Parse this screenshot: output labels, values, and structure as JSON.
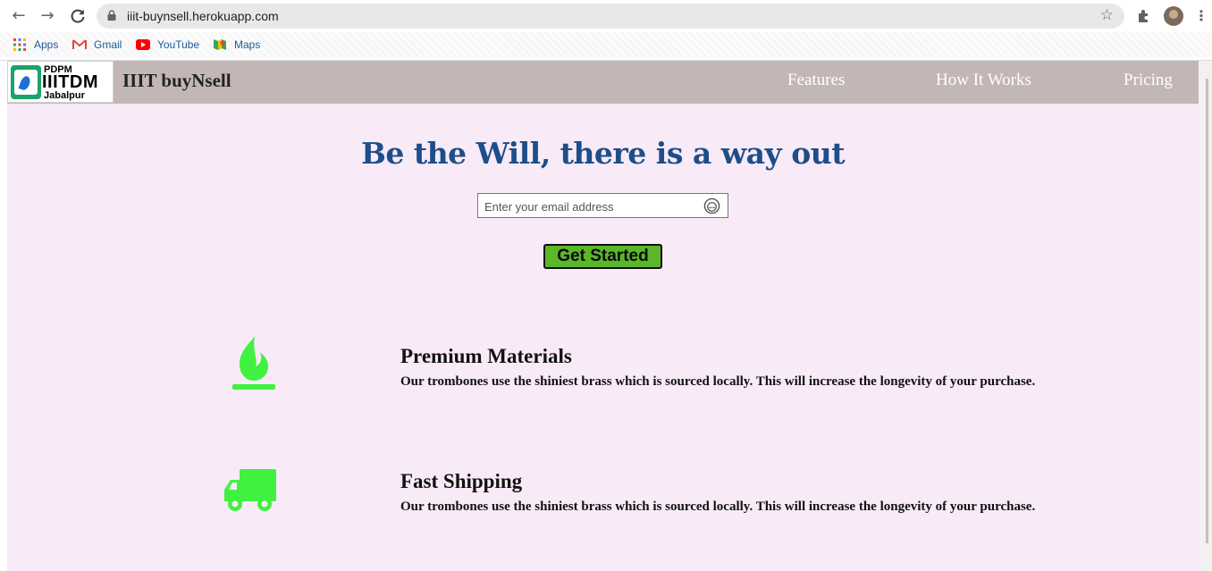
{
  "browser": {
    "url": "iiit-buynsell.herokuapp.com",
    "bookmarks": [
      {
        "label": "Apps",
        "icon": "apps-grid-icon"
      },
      {
        "label": "Gmail",
        "icon": "gmail-icon"
      },
      {
        "label": "YouTube",
        "icon": "youtube-icon"
      },
      {
        "label": "Maps",
        "icon": "maps-icon"
      }
    ]
  },
  "header": {
    "logo": {
      "line1": "PDPM",
      "line2": "IIITDM",
      "line3": "Jabalpur"
    },
    "brand": "IIIT buyNsell",
    "nav": [
      "Features",
      "How It Works",
      "Pricing"
    ]
  },
  "hero": {
    "title": "Be the Will, there is a way out",
    "email_placeholder": "Enter your email address",
    "cta": "Get Started"
  },
  "features": [
    {
      "icon": "fire-icon",
      "title": "Premium Materials",
      "desc": "Our trombones use the shiniest brass which is sourced locally. This will increase the longevity of your purchase."
    },
    {
      "icon": "truck-icon",
      "title": "Fast Shipping",
      "desc": "Our trombones use the shiniest brass which is sourced locally. This will increase the longevity of your purchase."
    }
  ],
  "colors": {
    "accent": "#5ab72a",
    "icon_green": "#3ff23f",
    "title_blue": "#1d4e89",
    "header_bg": "#c3b7b6",
    "page_bg": "#f8eaf6"
  }
}
